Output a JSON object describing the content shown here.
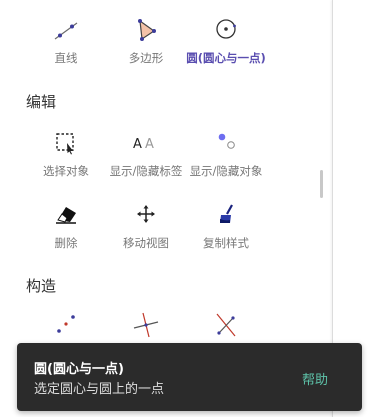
{
  "tools_top": [
    {
      "label": "直线",
      "icon": "line-icon",
      "selected": false
    },
    {
      "label": "多边形",
      "icon": "polygon-icon",
      "selected": false
    },
    {
      "label": "圆(圆心与一点)",
      "icon": "circle-center-point-icon",
      "selected": true
    }
  ],
  "sections": {
    "edit": {
      "title": "编辑",
      "row1": [
        {
          "label": "选择对象",
          "icon": "select-objects-icon"
        },
        {
          "label": "显示/隐藏标签",
          "icon": "show-hide-label-icon"
        },
        {
          "label": "显示/隐藏对象",
          "icon": "show-hide-object-icon"
        }
      ],
      "row2": [
        {
          "label": "删除",
          "icon": "eraser-icon"
        },
        {
          "label": "移动视图",
          "icon": "move-view-icon"
        },
        {
          "label": "复制样式",
          "icon": "copy-style-brush-icon"
        }
      ]
    },
    "construct": {
      "title": "构造",
      "row1": [
        {
          "icon": "midpoint-icon"
        },
        {
          "icon": "perpendicular-line-icon"
        },
        {
          "icon": "perpendicular-bisector-icon"
        }
      ]
    }
  },
  "toast": {
    "title": "圆(圆心与一点)",
    "description": "选定圆心与圆上的一点",
    "help_label": "帮助"
  },
  "colors": {
    "accent": "#5a4eb0",
    "help": "#5ec3aa",
    "toast_bg": "#2b2b2b"
  }
}
